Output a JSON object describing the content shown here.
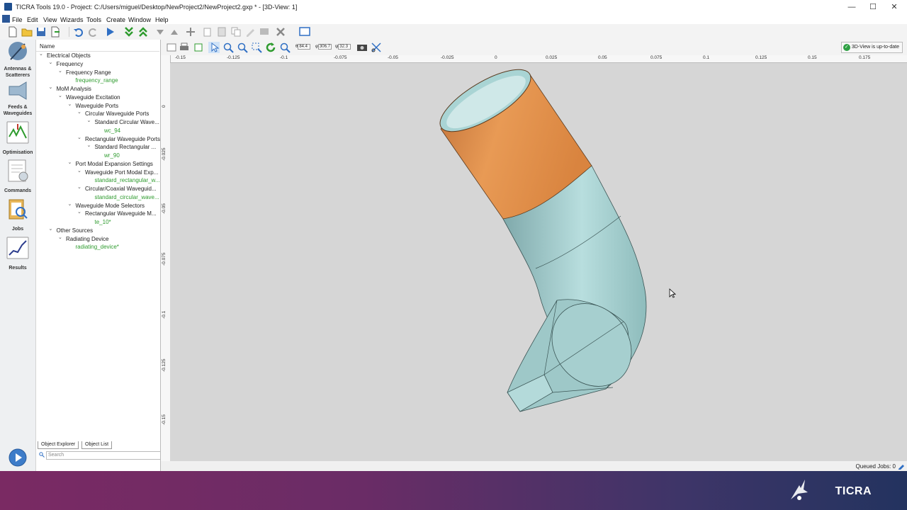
{
  "window": {
    "title": "TICRA Tools 19.0  - Project: C:/Users/miguel/Desktop/NewProject2/NewProject2.gxp * - [3D-View: 1]",
    "controls": [
      "—",
      "☐",
      "✕"
    ]
  },
  "menu": [
    "File",
    "Edit",
    "View",
    "Wizards",
    "Tools",
    "Create",
    "Window",
    "Help"
  ],
  "left_nav": [
    {
      "label": "Antennas & Scatterers",
      "icon": "antenna-icon"
    },
    {
      "label": "Feeds & Waveguides",
      "icon": "feed-icon"
    },
    {
      "label": "Optimisation",
      "icon": "optimisation-icon"
    },
    {
      "label": "Commands",
      "icon": "commands-icon"
    },
    {
      "label": "Jobs",
      "icon": "jobs-icon"
    },
    {
      "label": "Results",
      "icon": "results-icon"
    }
  ],
  "explorer": {
    "column_header": "Name",
    "tree": [
      {
        "label": "Electrical Objects",
        "depth": 0,
        "expanded": true,
        "leaf": false
      },
      {
        "label": "Frequency",
        "depth": 1,
        "expanded": true,
        "leaf": false
      },
      {
        "label": "Frequency Range",
        "depth": 2,
        "expanded": true,
        "leaf": false
      },
      {
        "label": "frequency_range",
        "depth": 3,
        "leaf": true
      },
      {
        "label": "MoM Analysis",
        "depth": 1,
        "expanded": true,
        "leaf": false
      },
      {
        "label": "Waveguide Excitation",
        "depth": 2,
        "expanded": true,
        "leaf": false
      },
      {
        "label": "Waveguide Ports",
        "depth": 3,
        "expanded": true,
        "leaf": false
      },
      {
        "label": "Circular Waveguide Ports",
        "depth": 4,
        "expanded": true,
        "leaf": false
      },
      {
        "label": "Standard Circular Wave...",
        "depth": 5,
        "expanded": true,
        "leaf": false
      },
      {
        "label": "wc_94",
        "depth": 6,
        "leaf": true
      },
      {
        "label": "Rectangular Waveguide Ports",
        "depth": 4,
        "expanded": true,
        "leaf": false
      },
      {
        "label": "Standard Rectangular ...",
        "depth": 5,
        "expanded": true,
        "leaf": false
      },
      {
        "label": "wr_90",
        "depth": 6,
        "leaf": true
      },
      {
        "label": "Port Modal Expansion Settings",
        "depth": 3,
        "expanded": true,
        "leaf": false
      },
      {
        "label": "Waveguide Port Modal Exp...",
        "depth": 4,
        "expanded": true,
        "leaf": false
      },
      {
        "label": "standard_rectangular_w...",
        "depth": 5,
        "leaf": true
      },
      {
        "label": "Circular/Coaxial Waveguid...",
        "depth": 4,
        "expanded": true,
        "leaf": false
      },
      {
        "label": "standard_circular_wave...",
        "depth": 5,
        "leaf": true
      },
      {
        "label": "Waveguide Mode Selectors",
        "depth": 3,
        "expanded": true,
        "leaf": false
      },
      {
        "label": "Rectangular Waveguide M...",
        "depth": 4,
        "expanded": true,
        "leaf": false
      },
      {
        "label": "te_10*",
        "depth": 5,
        "leaf": true
      },
      {
        "label": "Other Sources",
        "depth": 1,
        "expanded": true,
        "leaf": false
      },
      {
        "label": "Radiating Device",
        "depth": 2,
        "expanded": true,
        "leaf": false
      },
      {
        "label": "radiating_device*",
        "depth": 3,
        "leaf": true
      }
    ],
    "tabs": [
      "Object Explorer",
      "Object List"
    ],
    "search_placeholder": "Search"
  },
  "view": {
    "coords": {
      "theta": "84.4",
      "phi": "306.7",
      "psi": "32.3"
    },
    "status_badge": "3D-View is up-to-date",
    "h_ruler": [
      "-0.15",
      "-0.125",
      "-0.1",
      "-0.075",
      "-0.05",
      "-0.025",
      "0",
      "0.025",
      "0.05",
      "0.075",
      "0.1",
      "0.125",
      "0.15",
      "0.175"
    ],
    "v_ruler": [
      "0",
      "-0.025",
      "-0.05",
      "-0.075",
      "-0.1",
      "-0.125",
      "-0.15"
    ],
    "colors": {
      "viewport_bg": "#d6d6d6",
      "waveguide": "#9fc9c9",
      "port": "#e0924a"
    }
  },
  "status": {
    "queued_jobs": "Queued Jobs: 0"
  },
  "footer": {
    "brand": "TICRA"
  }
}
